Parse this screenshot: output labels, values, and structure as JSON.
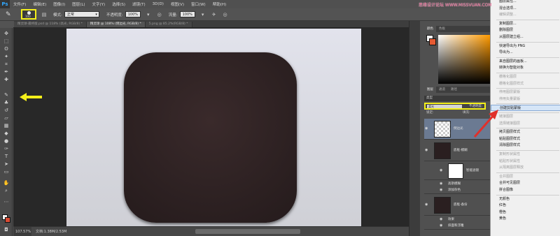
{
  "app": {
    "logo": "Ps",
    "menus": [
      "文件(F)",
      "编辑(E)",
      "图像(I)",
      "图层(L)",
      "文字(Y)",
      "选择(S)",
      "滤镜(T)",
      "3D(D)",
      "视图(V)",
      "窗口(W)",
      "帮助(H)"
    ]
  },
  "options": {
    "brush_size": "100",
    "mode_label": "模式:",
    "mode_value": "正常",
    "opacity_label": "不透明度:",
    "opacity_value": "100%",
    "flow_label": "流量:",
    "flow_value": "100%"
  },
  "tabs": [
    {
      "label": "精灵球-最终版.psd @ 118% (高光, RGB/8) *",
      "active": false
    },
    {
      "label": "精灵球 @ 108% (倒边光, RGB/8) *",
      "active": true
    },
    {
      "label": "5.png @ 85.2%(RGB/8) *",
      "active": false
    }
  ],
  "status": {
    "zoom": "107.57%",
    "doc": "文档:1.38M/2.53M"
  },
  "panels": {
    "color_tabs": [
      "颜色",
      "色板"
    ],
    "layer_tabs": [
      "图层",
      "通道",
      "路径"
    ],
    "search_label": "类型",
    "blend_mode": "柔光",
    "opacity_label": "不透明度:",
    "lock_label": "锁定:",
    "fill_label": "填充:",
    "layers": [
      {
        "name": "倒边光"
      },
      {
        "name": "底框-模糊"
      },
      {
        "name": "智能滤镜"
      },
      {
        "name": "高斯模糊"
      },
      {
        "name": "添加杂色"
      },
      {
        "name": "底框-备份"
      },
      {
        "name": "效果"
      },
      {
        "name": "斜面和浮雕"
      }
    ]
  },
  "context_menu": {
    "items": [
      {
        "label": "图层属性...",
        "disabled": false
      },
      {
        "label": "混合选项...",
        "disabled": false
      },
      {
        "label": "编辑调整...",
        "disabled": true
      },
      {
        "label": "复制图层...",
        "disabled": false
      },
      {
        "label": "删除图层",
        "disabled": false
      },
      {
        "label": "从图层建立组...",
        "disabled": false
      },
      {
        "label": "快速导出为 PNG",
        "disabled": false
      },
      {
        "label": "导出为...",
        "disabled": false
      },
      {
        "label": "来自图层的画板...",
        "disabled": false
      },
      {
        "label": "转换为智能对象",
        "disabled": false
      },
      {
        "label": "栅格化图层",
        "disabled": true
      },
      {
        "label": "栅格化图层样式",
        "disabled": true
      },
      {
        "label": "停用图层蒙版",
        "disabled": true
      },
      {
        "label": "停用矢量蒙版",
        "disabled": true
      },
      {
        "label": "创建剪贴蒙版",
        "disabled": false,
        "highlight": true
      },
      {
        "label": "链接图层",
        "disabled": true
      },
      {
        "label": "选择链接图层",
        "disabled": true
      },
      {
        "label": "拷贝图层样式",
        "disabled": false
      },
      {
        "label": "粘贴图层样式",
        "disabled": false
      },
      {
        "label": "清除图层样式",
        "disabled": false
      },
      {
        "label": "复制形状属性",
        "disabled": true
      },
      {
        "label": "粘贴形状属性",
        "disabled": true
      },
      {
        "label": "从隔离图层释放",
        "disabled": true
      },
      {
        "label": "合并图层",
        "disabled": true
      },
      {
        "label": "合并可见图层",
        "disabled": false
      },
      {
        "label": "拼合图像",
        "disabled": false
      },
      {
        "label": "无颜色",
        "disabled": false
      },
      {
        "label": "红色",
        "disabled": false
      },
      {
        "label": "橙色",
        "disabled": false
      },
      {
        "label": "黄色",
        "disabled": false
      }
    ]
  },
  "watermark": "思缘设计论坛 WWW.MISSVUAN.COM",
  "colors": {
    "highlight_box": "#f3ef1a",
    "icon_fill": "#2d2122",
    "arrow_red": "#e0302a"
  }
}
